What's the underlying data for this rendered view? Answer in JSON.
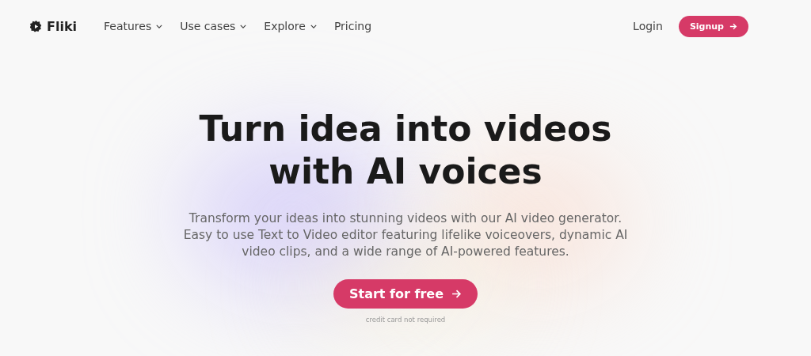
{
  "brand": {
    "name": "Fliki"
  },
  "nav": [
    {
      "label": "Features",
      "has_menu": true
    },
    {
      "label": "Use cases",
      "has_menu": true
    },
    {
      "label": "Explore",
      "has_menu": true
    },
    {
      "label": "Pricing",
      "has_menu": false
    }
  ],
  "login": "Login",
  "signup": "Signup",
  "hero": {
    "title_lines": [
      "Turn idea into videos",
      "with AI voices"
    ],
    "subtitle_lines": [
      "Transform your ideas into stunning videos with our AI video generator.",
      "Easy to use Text to Video editor featuring lifelike voiceovers, dynamic AI",
      "video clips, and a wide range of AI-powered features."
    ],
    "cta": "Start for free",
    "note": "credit card not required"
  }
}
